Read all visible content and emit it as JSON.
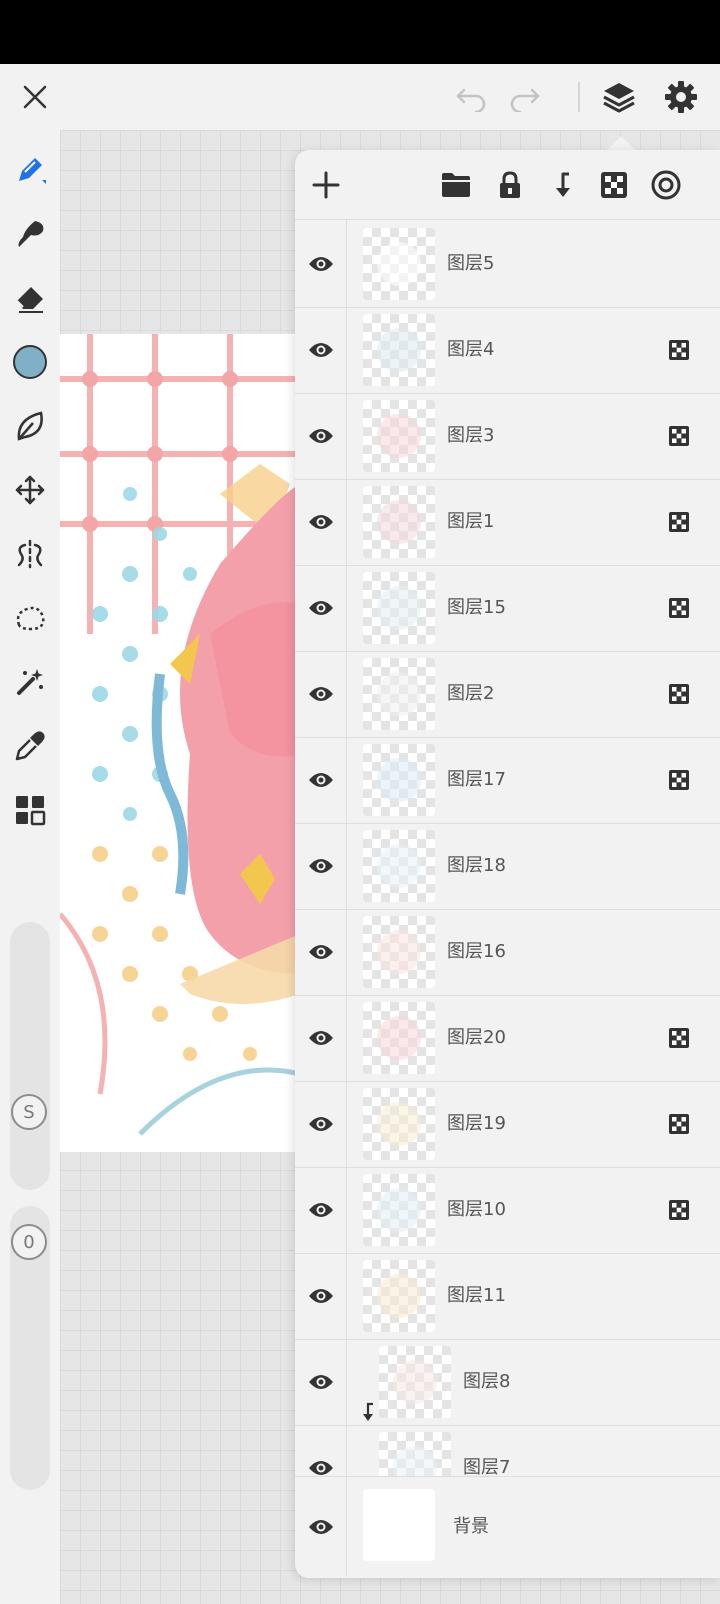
{
  "app": {
    "accent_color": "#1e73e8",
    "current_color": "#7fb0c6"
  },
  "topbar": {
    "close_icon": "close-icon",
    "undo_icon": "undo-icon",
    "redo_icon": "redo-icon",
    "layers_icon": "layers-icon",
    "settings_icon": "gear-icon"
  },
  "toolbar": {
    "tools": [
      "pen",
      "brush",
      "eraser",
      "color",
      "lasso-fill",
      "transform",
      "symmetry",
      "selection",
      "magic-wand",
      "eyedropper",
      "layer-grid"
    ],
    "size_badge": "S",
    "opacity_badge": "0"
  },
  "layers_panel": {
    "actions": [
      "add-layer",
      "folder",
      "lock",
      "clip",
      "alpha-lock",
      "blend"
    ],
    "layers": [
      {
        "name": "图层5",
        "alpha_locked": false,
        "clipped": false
      },
      {
        "name": "图层4",
        "alpha_locked": true,
        "clipped": false
      },
      {
        "name": "图层3",
        "alpha_locked": true,
        "clipped": false
      },
      {
        "name": "图层1",
        "alpha_locked": true,
        "clipped": false
      },
      {
        "name": "图层15",
        "alpha_locked": true,
        "clipped": false
      },
      {
        "name": "图层2",
        "alpha_locked": true,
        "clipped": false
      },
      {
        "name": "图层17",
        "alpha_locked": true,
        "clipped": false
      },
      {
        "name": "图层18",
        "alpha_locked": false,
        "clipped": false
      },
      {
        "name": "图层16",
        "alpha_locked": false,
        "clipped": false
      },
      {
        "name": "图层20",
        "alpha_locked": true,
        "clipped": false
      },
      {
        "name": "图层19",
        "alpha_locked": true,
        "clipped": false
      },
      {
        "name": "图层10",
        "alpha_locked": true,
        "clipped": false
      },
      {
        "name": "图层11",
        "alpha_locked": false,
        "clipped": false
      },
      {
        "name": "图层8",
        "alpha_locked": false,
        "clipped": true
      },
      {
        "name": "图层7",
        "alpha_locked": false,
        "clipped": false
      }
    ],
    "background_layer": "背景"
  }
}
